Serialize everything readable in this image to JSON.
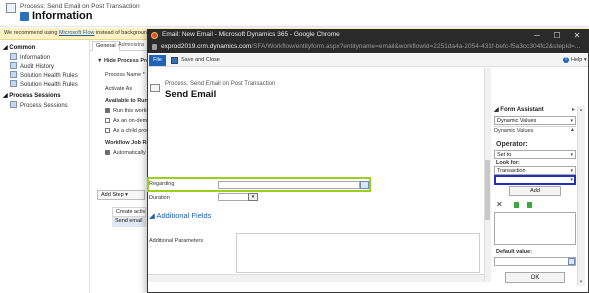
{
  "background_page": {
    "process_label": "Process: Send Email on Post Transaction",
    "process_title": "Information",
    "notice": {
      "prefix": "We recommend using ",
      "link": "Microsoft Flow",
      "suffix": " instead of background w"
    },
    "nav": {
      "common_heading": "◢ Common",
      "common_items": [
        "Information",
        "Audit History",
        "Solution Health Rules",
        "Solution Health Rules"
      ],
      "sessions_heading": "◢ Process Sessions",
      "sessions_items": [
        "Process Sessions"
      ]
    },
    "tabs": [
      "General",
      "Administra"
    ],
    "section_heading": "▼ Hide Process Pro",
    "fields": [
      "Process Name *",
      "Activate As"
    ],
    "available_heading": "Available to Run",
    "available_options": [
      "Run this workf",
      "As an on-dema",
      "As a child proc"
    ],
    "job_heading": "Workflow Job Re",
    "job_option": "Automatically",
    "add_step": "Add Step ▾",
    "steps": [
      "Create activ",
      "Send email"
    ]
  },
  "modal": {
    "window_title": "Email: New Email - Microsoft Dynamics 365 - Google Chrome",
    "window_buttons": {
      "minimize": "─",
      "maximize": "☐",
      "close": "✕"
    },
    "url_host": "exprod2019.crm.dynamics.com",
    "url_path": "/SFA/Workflow/entityform.aspx?entityname=email&workflowId=2251da4a-2054-431f-befc-f5a3cc304fc2&stepId=...",
    "toolbar": {
      "file": "File",
      "save_close": "Save and Close",
      "help": "Help ▾",
      "help_q": "?"
    },
    "form": {
      "process_label": "Process: Send Email on Post Transaction",
      "title": "Send Email",
      "regarding_label": "Regarding",
      "duration_label": "Duration",
      "duration_caret": "▾",
      "additional_fields": "◢ Additional Fields",
      "additional_params_label": "Additional Parameters"
    },
    "form_assistant": {
      "heading": "◢ Form Assistant",
      "collapse": "▸",
      "dynamic_values_select": "Dynamic Values",
      "dynamic_values_sub": "Dynamic Values",
      "sub_caret": "▲",
      "operator_label": "Operator:",
      "operator_value": "Set to",
      "look_for_label": "Look for:",
      "look_for_value": "Transaction",
      "add_button": "Add",
      "remove_icon": "✕",
      "default_value_label": "Default value:",
      "ok_button": "OK",
      "caret": "▾",
      "scroll_up": "▴",
      "scroll_down": "▾"
    }
  },
  "colors": {
    "highlight_green": "#9bd11e",
    "highlight_blue": "#2530b8",
    "brand_blue": "#2062b8",
    "chrome_titlebar": "#2a2a2a"
  }
}
